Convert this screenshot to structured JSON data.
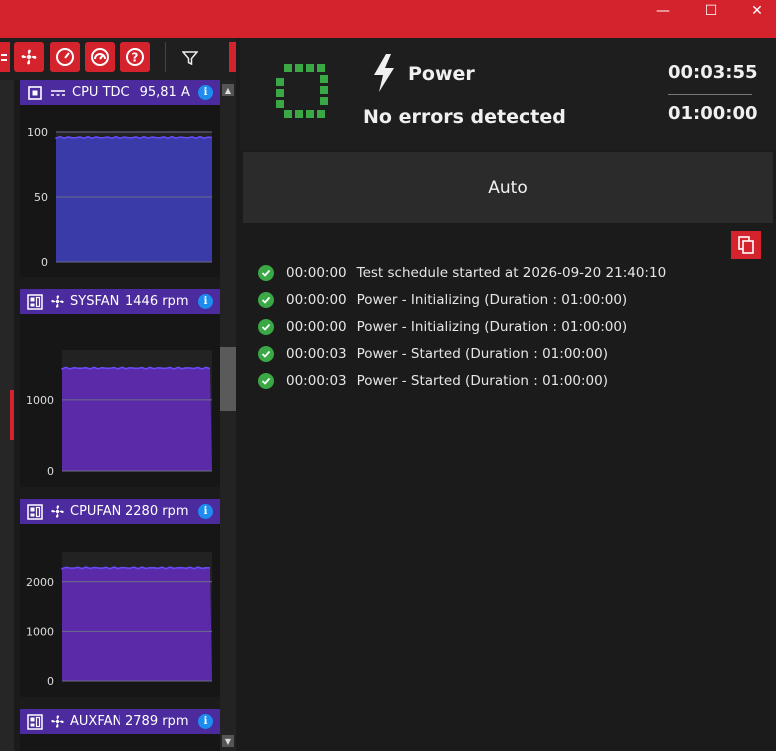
{
  "window": {
    "minimize": "—",
    "maximize": "☐",
    "close": "✕"
  },
  "toolbar": {
    "icons": [
      "list-icon",
      "fan-icon",
      "gauge-icon",
      "speedometer-icon",
      "help-icon",
      "filter-icon"
    ]
  },
  "sensors": [
    {
      "label": "CPU TDC",
      "value": "95,81 A",
      "icon": "cpu-icon",
      "sub_icon": "dc-current-icon",
      "y_ticks": [
        "100",
        "50",
        "0"
      ],
      "ylim": [
        0,
        100
      ],
      "level": 95.8,
      "color": "#3a3aa8"
    },
    {
      "label": "SYSFAN",
      "value": "1446 rpm",
      "icon": "motherboard-icon",
      "sub_icon": "fan-icon",
      "y_ticks": [
        "1000",
        "0"
      ],
      "ylim": [
        0,
        1700
      ],
      "level": 1446,
      "color": "#5a2aa8"
    },
    {
      "label": "CPUFAN",
      "value": "2280 rpm",
      "icon": "motherboard-icon",
      "sub_icon": "fan-icon",
      "y_ticks": [
        "2000",
        "1000",
        "0"
      ],
      "ylim": [
        0,
        2600
      ],
      "level": 2280,
      "color": "#5a2aa8"
    },
    {
      "label": "AUXFAN",
      "value": "2789 rpm",
      "icon": "motherboard-icon",
      "sub_icon": "fan-icon"
    }
  ],
  "status": {
    "test_name": "Power",
    "message": "No errors detected",
    "elapsed": "00:03:55",
    "duration": "01:00:00",
    "mode_label": "Auto",
    "accent": "#3aa845"
  },
  "log": [
    {
      "time": "00:00:00",
      "text": "Test schedule started at 2026-09-20 21:40:10"
    },
    {
      "time": "00:00:00",
      "text": "Power - Initializing (Duration : 01:00:00)"
    },
    {
      "time": "00:00:00",
      "text": "Power - Initializing (Duration : 01:00:00)"
    },
    {
      "time": "00:00:03",
      "text": "Power - Started (Duration : 01:00:00)"
    },
    {
      "time": "00:00:03",
      "text": "Power - Started (Duration : 01:00:00)"
    }
  ]
}
